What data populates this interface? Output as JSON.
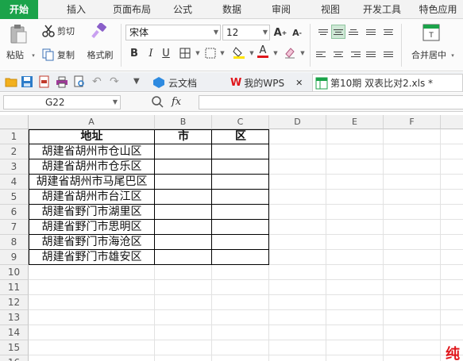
{
  "menu": {
    "tabs": [
      "开始",
      "插入",
      "页面布局",
      "公式",
      "数据",
      "审阅",
      "视图",
      "开发工具",
      "特色应用"
    ]
  },
  "ribbon": {
    "paste_label": "粘贴",
    "cut_label": "剪切",
    "copy_label": "复制",
    "format_painter_label": "格式刷",
    "font_name": "宋体",
    "font_size": "12",
    "merge_center_label": "合并居中"
  },
  "doc_tabs": [
    {
      "label": "云文档",
      "closable": false
    },
    {
      "label": "我的WPS",
      "closable": true
    },
    {
      "label": "第10期 双表比对2.xls *",
      "closable": true
    }
  ],
  "formula_bar": {
    "name_box": "G22",
    "fx_label": "fx",
    "formula": ""
  },
  "sheet": {
    "columns": [
      "A",
      "B",
      "C",
      "D",
      "E",
      "F"
    ],
    "rows": [
      "1",
      "2",
      "3",
      "4",
      "5",
      "6",
      "7",
      "8",
      "9",
      "10",
      "11",
      "12",
      "13",
      "14",
      "15",
      "16"
    ],
    "header_row": [
      "地址",
      "市",
      "区"
    ],
    "addresses": [
      "胡建省胡州市仓山区",
      "胡建省胡州市仓乐区",
      "胡建省胡州市马尾巴区",
      "胡建省胡州市台江区",
      "胡建省野门市湖里区",
      "胡建省野门市思明区",
      "胡建省野门市海沧区",
      "胡建省野门市雄安区"
    ]
  },
  "watermark": "纯",
  "colors": {
    "accent_green": "#1ba34a",
    "watermark_red": "#e0161b"
  }
}
